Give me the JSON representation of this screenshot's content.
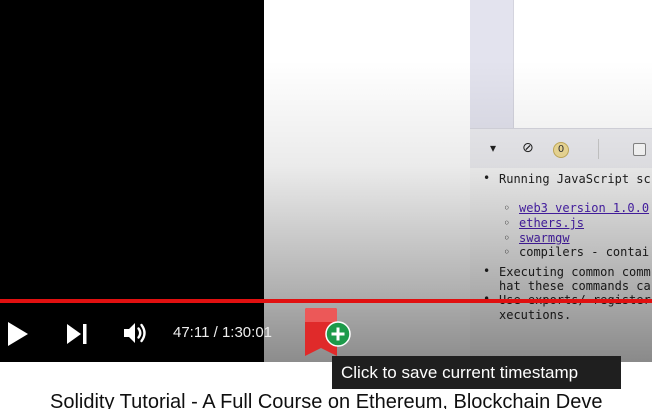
{
  "player": {
    "time_current": "47:11",
    "time_separator": "/",
    "time_total": "1:30:01",
    "progress_fraction": 0.524,
    "accent_color": "#e01010"
  },
  "ide": {
    "toolbar": {
      "collapse_icon": "double-chevron-down-icon",
      "clear_icon": "ban-icon",
      "count_badge": "0"
    },
    "doc_lines": [
      {
        "kind": "text",
        "text": "Running JavaScript sc"
      },
      {
        "kind": "link",
        "text": "web3 version 1.0.0"
      },
      {
        "kind": "link",
        "text": "ethers.js"
      },
      {
        "kind": "link",
        "text": "swarmgw"
      },
      {
        "kind": "text",
        "text": "compilers - contai"
      },
      {
        "kind": "text",
        "text": "Executing common comm"
      },
      {
        "kind": "text",
        "text": "hat these commands ca"
      },
      {
        "kind": "text",
        "text": "Use exports/ register"
      },
      {
        "kind": "text",
        "text": "xecutions."
      }
    ]
  },
  "tooltip": {
    "text": "Click to save current timestamp"
  },
  "video": {
    "title": "Solidity Tutorial - A Full Course on Ethereum, Blockchain Deve"
  },
  "icons": [
    "play-icon",
    "skip-next-icon",
    "volume-icon",
    "bookmark-plus-icon"
  ]
}
